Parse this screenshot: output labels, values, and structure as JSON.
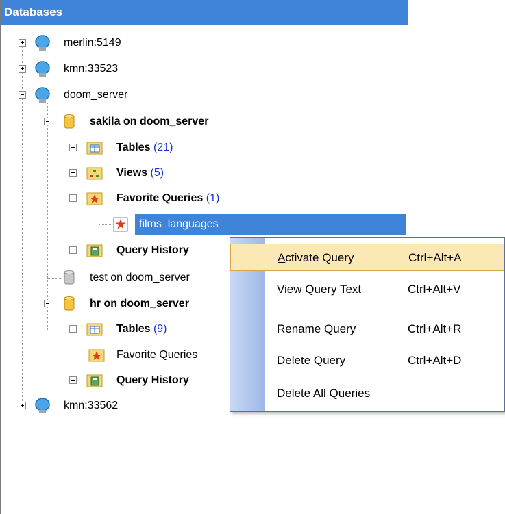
{
  "panel": {
    "title": "Databases"
  },
  "tree": {
    "merlin": "merlin:5149",
    "kmn1": "kmn:33523",
    "doom": "doom_server",
    "sakila": "sakila on doom_server",
    "sakila_tables": "Tables",
    "sakila_tables_count": "(21)",
    "sakila_views": "Views",
    "sakila_views_count": "(5)",
    "sakila_fav": "Favorite Queries",
    "sakila_fav_count": "(1)",
    "films": "films_languages",
    "sakila_history": "Query History",
    "test": "test on doom_server",
    "hr": "hr on doom_server",
    "hr_tables": "Tables",
    "hr_tables_count": "(9)",
    "hr_fav": "Favorite Queries",
    "hr_history": "Query History",
    "kmn2": "kmn:33562"
  },
  "menu": {
    "items": [
      {
        "label": "Activate Query",
        "mnemonic": "A",
        "rest": "ctivate Query",
        "shortcut": "Ctrl+Alt+A"
      },
      {
        "label": "View Query Text",
        "shortcut": "Ctrl+Alt+V"
      },
      {
        "label": "Rename Query",
        "shortcut": "Ctrl+Alt+R"
      },
      {
        "label": "Delete Query",
        "mnemonic": "D",
        "rest": "elete Query",
        "shortcut": "Ctrl+Alt+D"
      },
      {
        "label": "Delete All Queries",
        "shortcut": ""
      }
    ]
  },
  "colors": {
    "header": "#3f84d8",
    "selection": "#3f84d8",
    "count": "#1a33d6",
    "menu_highlight": "#fce8b4"
  }
}
